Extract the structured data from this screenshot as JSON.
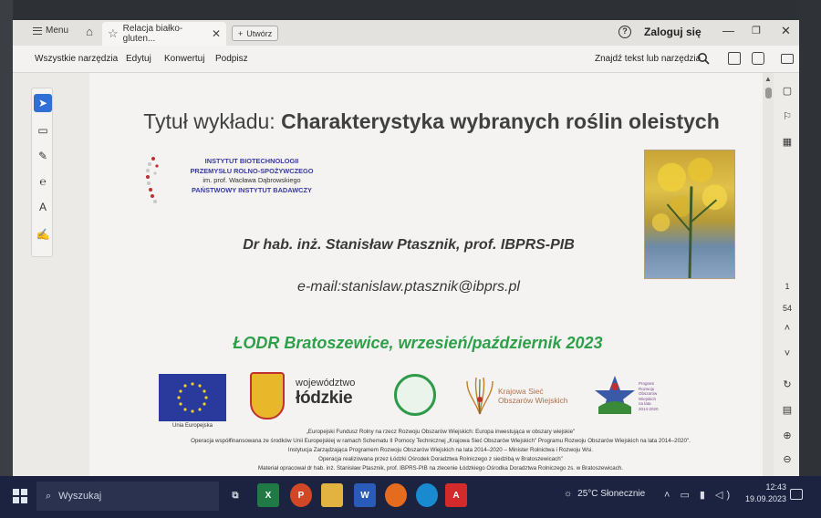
{
  "tabbar": {
    "menu_label": "Menu",
    "tab_title": "Relacja białko-gluten...",
    "new_tab_label": "Utwórz",
    "login_label": "Zaloguj się"
  },
  "toolbar": {
    "items": [
      "Wszystkie narzędzia",
      "Edytuj",
      "Konwertuj",
      "Podpisz"
    ],
    "find_label": "Znajdź tekst lub narzędzia"
  },
  "page_nav": {
    "current_page": "1",
    "total_pages": "54"
  },
  "slide": {
    "title_prefix": "Tytuł wykładu: ",
    "title_main": "Charakterystyka wybranych roślin oleistych",
    "institute_lines": [
      "INSTYTUT BIOTECHNOLOGII",
      "PRZEMYSŁU ROLNO-SPOŻYWCZEGO",
      "im. prof. Wacława Dąbrowskiego",
      "PAŃSTWOWY INSTYTUT BADAWCZY"
    ],
    "author": "Dr hab. inż. Stanisław Ptasznik, prof. IBPRS-PIB",
    "email": "e-mail:stanislaw.ptasznik@ibprs.pl",
    "event": "ŁODR Bratoszewice, wrzesień/październik 2023",
    "eu_caption": "Unia Europejska",
    "lodz_line1": "województwo",
    "lodz_line2": "łódzkie",
    "ksow_line1": "Krajowa Sieć",
    "ksow_line2": "Obszarów Wiejskich",
    "prow_lines": [
      "Program",
      "Rozwoju",
      "Obszarów",
      "Wiejskich",
      "na lata 2014-2020"
    ],
    "footer_lines": [
      "„Europejski Fundusz Rolny na rzecz Rozwoju Obszarów Wiejskich: Europa inwestująca w obszary wiejskie\"",
      "Operacja współfinansowana ze środków Unii Europejskiej w ramach Schematu II Pomocy Technicznej „Krajowa Sieć Obszarów Wiejskich\" Programu Rozwoju Obszarów Wiejskich na lata 2014–2020\".",
      "Instytucja Zarządzająca Programem Rozwoju Obszarów Wiejskich na lata 2014–2020 – Minister Rolnictwa i Rozwoju Wsi.",
      "Operacja realizowana przez Łódzki Ośrodek Doradztwa Rolniczego z siedzibą w Bratoszewicach\"",
      "Materiał opracował dr hab. inż. Stanisław Ptasznik, prof. IBPRS-PIB na zlecenie Łódzkiego Ośrodka Doradztwa Rolniczego zs. w Bratoszewicach."
    ]
  },
  "taskbar": {
    "search_placeholder": "Wyszukaj",
    "weather": "25°C Słonecznie",
    "time": "12:43",
    "date": "19.09.2023"
  },
  "colors": {
    "accent": "#2f6fd6",
    "event_green": "#2fa04a",
    "institute_blue": "#3a3aa0",
    "taskbar": "#1b2340"
  }
}
